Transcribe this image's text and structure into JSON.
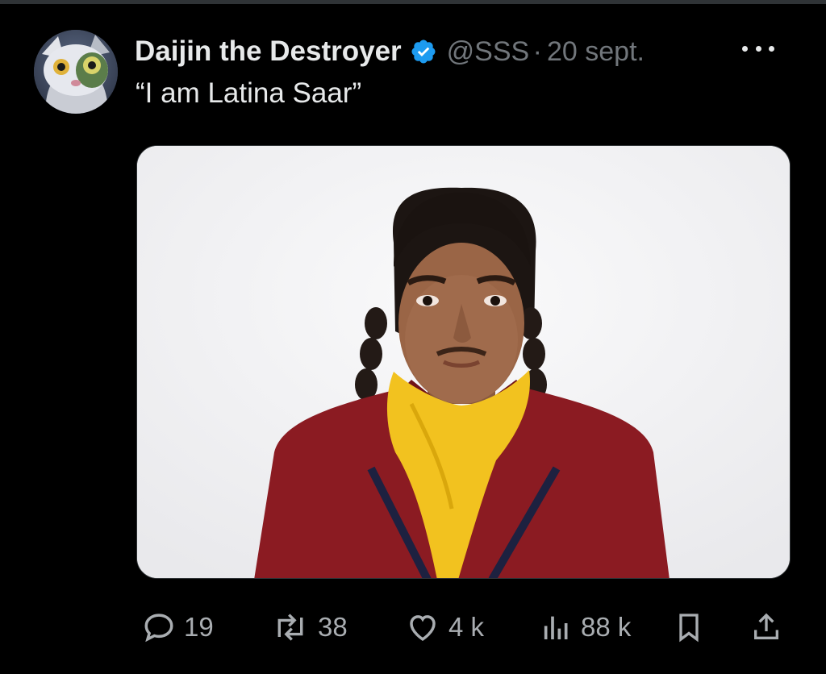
{
  "tweet": {
    "author_name": "Daijin the Destroyer",
    "handle": "@SSS",
    "separator": "·",
    "date": "20 sept.",
    "text": "“I am Latina Saar”",
    "media_description_icon": "photo-of-person-in-school-uniform"
  },
  "actions": {
    "replies": "19",
    "reposts": "38",
    "likes": "4 k",
    "views": "88 k"
  },
  "icons": [
    "reply-icon",
    "repost-icon",
    "like-icon",
    "views-icon",
    "bookmark-icon",
    "share-icon",
    "more-icon",
    "verified-badge-icon"
  ],
  "colors": {
    "background": "#000000",
    "primary_text": "#e7e9ea",
    "secondary_text": "#71767b",
    "verified_blue": "#1d9bf0"
  }
}
